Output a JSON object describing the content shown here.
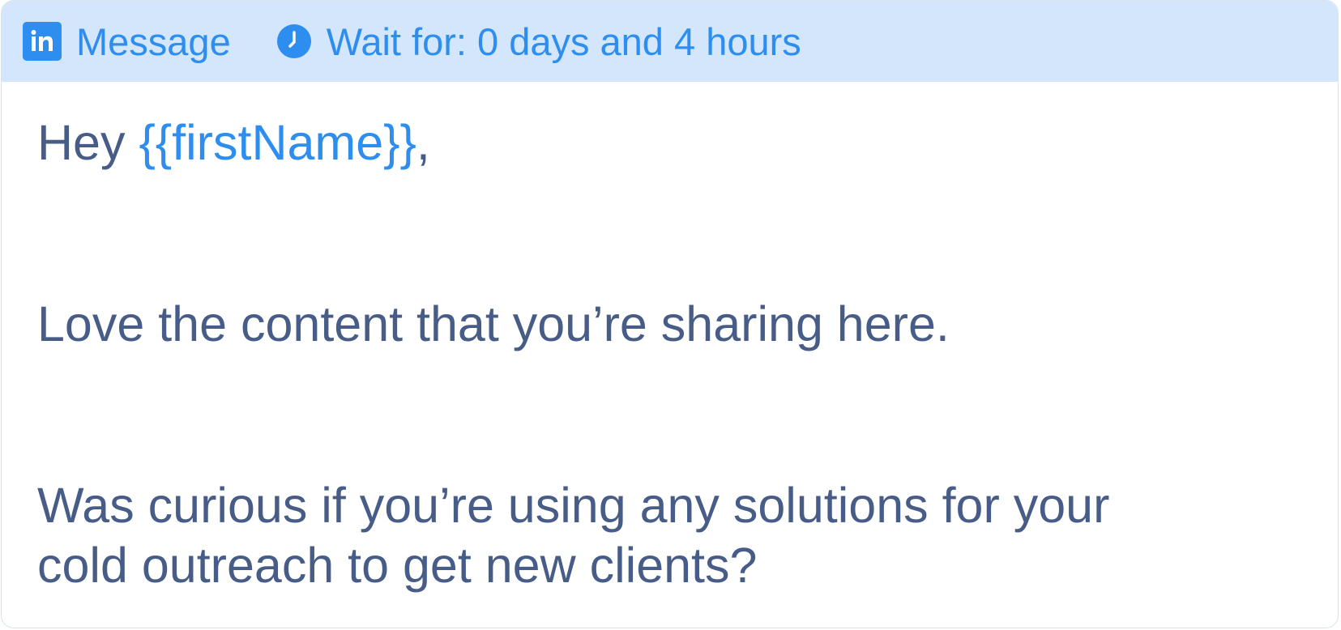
{
  "header": {
    "channel_label": "Message",
    "wait_label": "Wait for: 0 days and 4 hours",
    "channel_icon": "linkedin-icon",
    "wait_icon": "clock-icon",
    "accent_color": "#2d8ef0",
    "background_color": "#d3e6fb"
  },
  "message": {
    "greeting_prefix": "Hey ",
    "greeting_variable": "{{firstName}}",
    "greeting_suffix": ",",
    "paragraph_1": "Love the content that you’re sharing here.",
    "paragraph_2_line_1": "Was curious if you’re using any solutions for your",
    "paragraph_2_line_2": "cold outreach to get new clients?",
    "text_color": "#475d88"
  }
}
